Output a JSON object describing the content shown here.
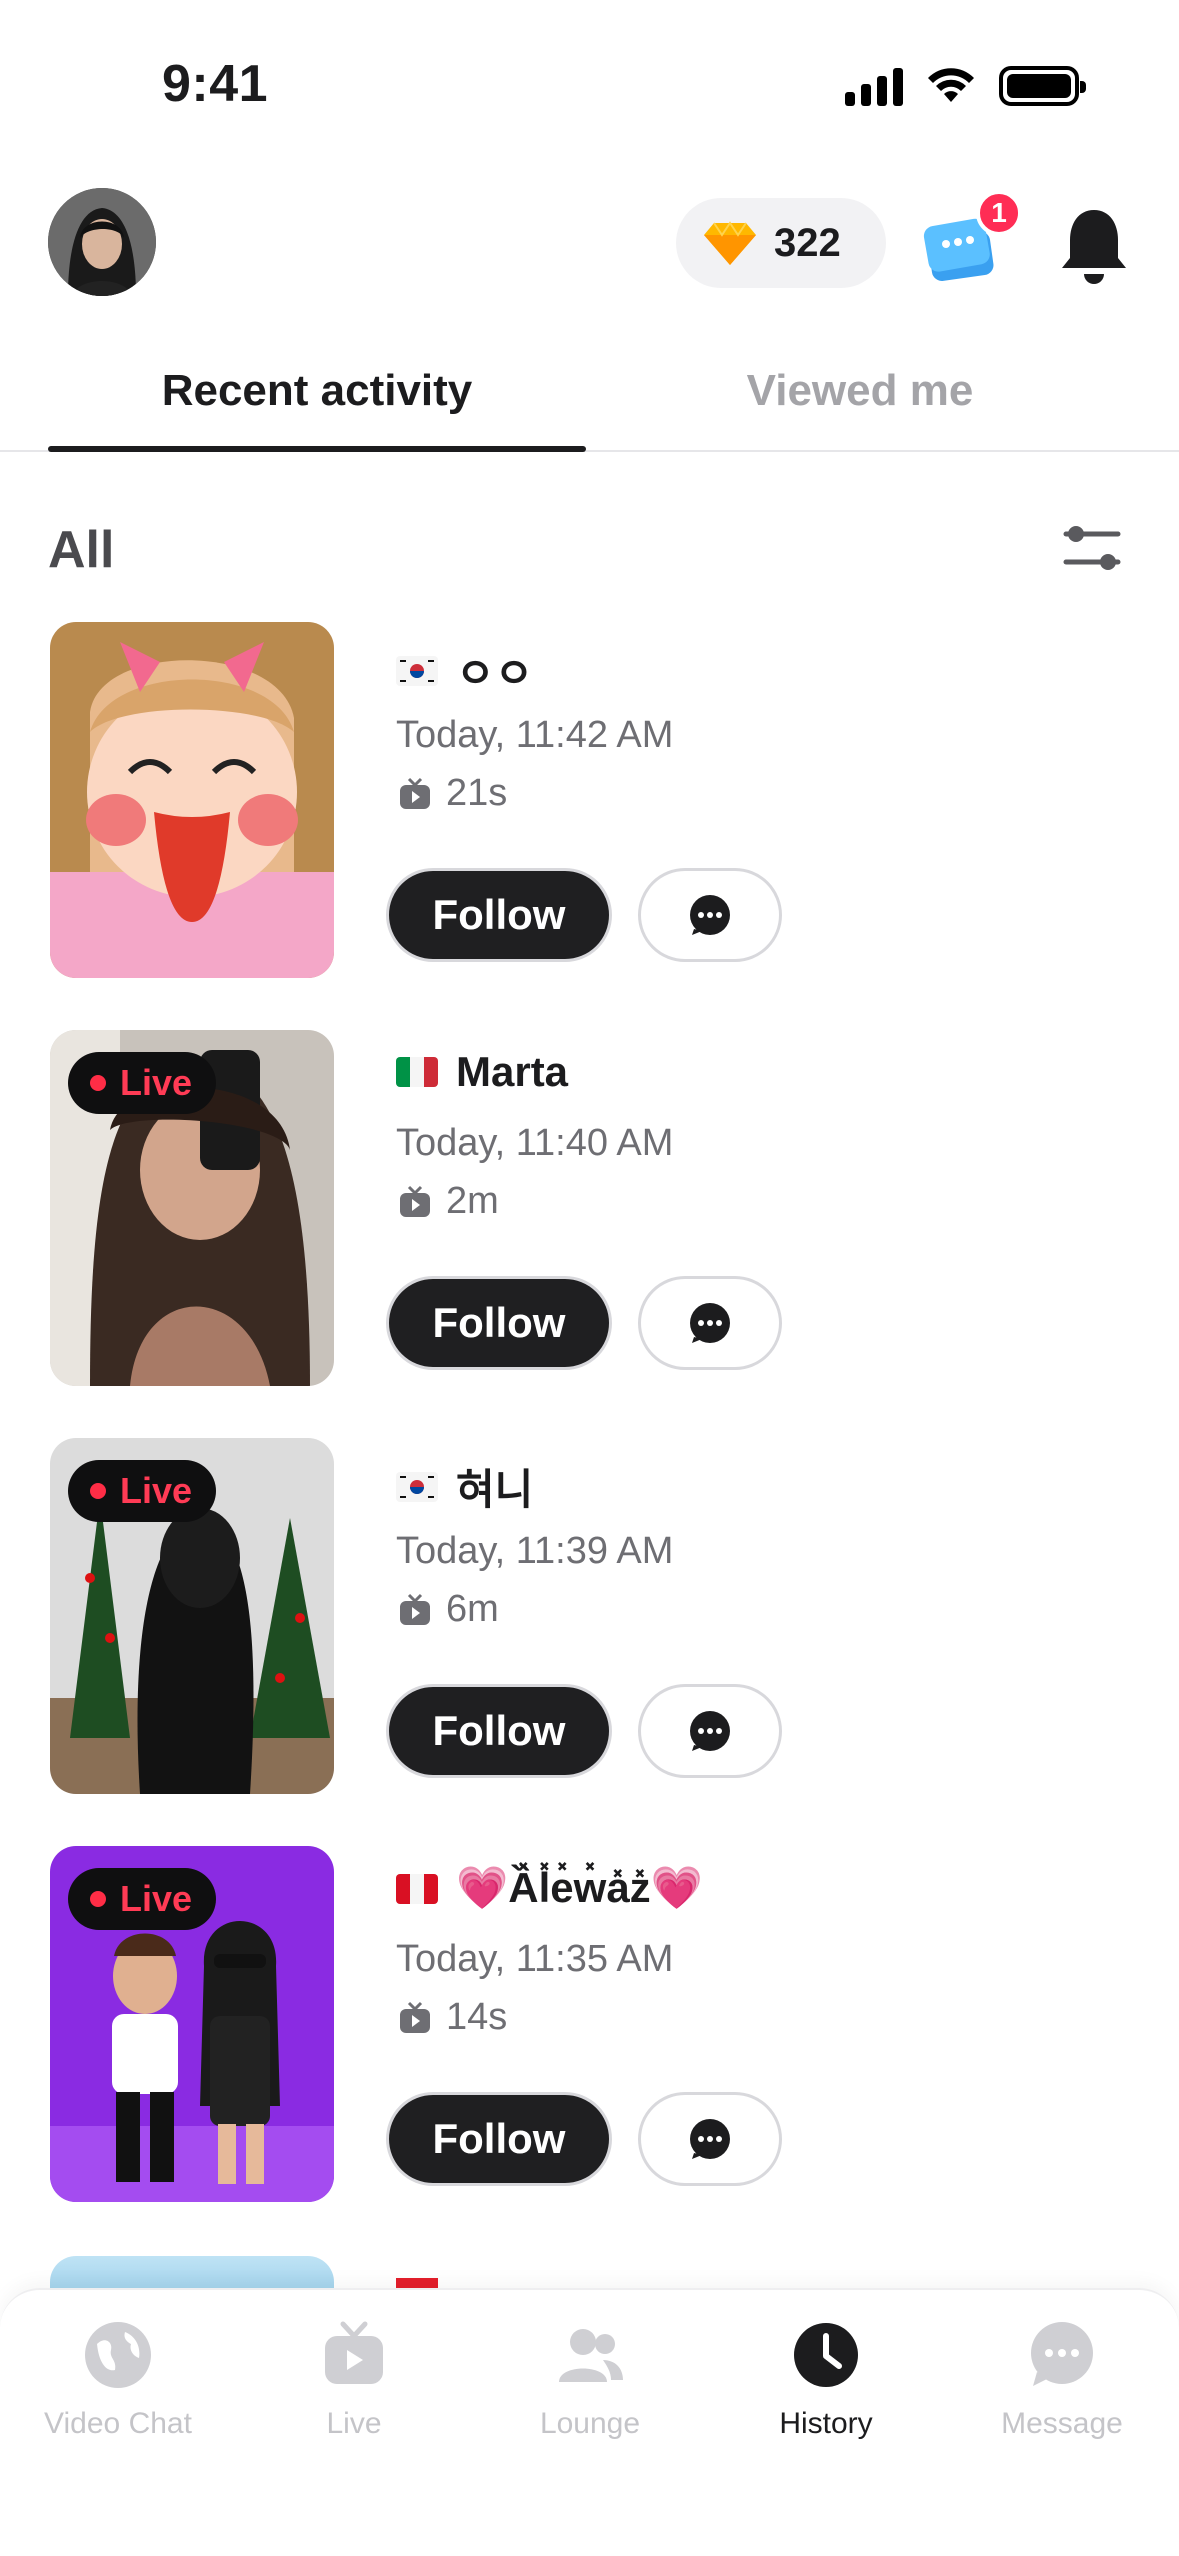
{
  "status_bar": {
    "time": "9:41"
  },
  "header": {
    "gem_count": "322",
    "chat_badge": "1"
  },
  "tabs": [
    {
      "label": "Recent activity",
      "active": true
    },
    {
      "label": "Viewed me",
      "active": false
    }
  ],
  "filter": {
    "label": "All"
  },
  "list": [
    {
      "flag": "KR",
      "name": "ㅇㅇ",
      "time": "Today, 11:42 AM",
      "duration": "21s",
      "live": false,
      "follow_label": "Follow"
    },
    {
      "flag": "IT",
      "name": "Marta",
      "time": "Today, 11:40 AM",
      "duration": "2m",
      "live": true,
      "live_label": "Live",
      "follow_label": "Follow"
    },
    {
      "flag": "KR",
      "name": "혀니",
      "time": "Today, 11:39 AM",
      "duration": "6m",
      "live": true,
      "live_label": "Live",
      "follow_label": "Follow"
    },
    {
      "flag": "PE",
      "name": "💗Ȁ̽l̽e̽w̽a̽z̽💗",
      "time": "Today, 11:35 AM",
      "duration": "14s",
      "live": true,
      "live_label": "Live",
      "follow_label": "Follow"
    }
  ],
  "bottom_nav": [
    {
      "label": "Video Chat",
      "icon": "globe-icon",
      "active": false
    },
    {
      "label": "Live",
      "icon": "tv-icon",
      "active": false
    },
    {
      "label": "Lounge",
      "icon": "people-icon",
      "active": false
    },
    {
      "label": "History",
      "icon": "clock-icon",
      "active": true
    },
    {
      "label": "Message",
      "icon": "chat-bubble-icon",
      "active": false
    }
  ],
  "colors": {
    "accent_live": "#ff3b55",
    "button_dark": "#1f1f21",
    "gem": "#ffb800",
    "badge": "#ff2d55"
  }
}
